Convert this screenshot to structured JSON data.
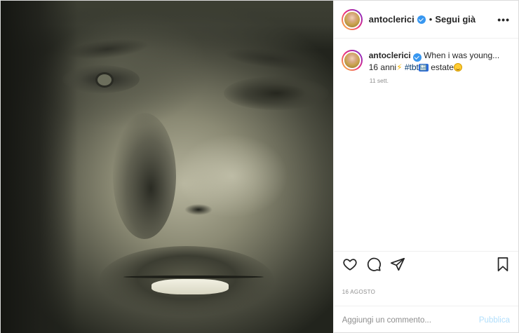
{
  "post": {
    "username": "antoclerici",
    "follow_label": "Segui già",
    "separator": "•",
    "more_label": "•••",
    "caption": {
      "username": "antoclerici",
      "text_part1": "When i was young... 16 anni",
      "bolt_emoji": "⚡",
      "hashtag": "#tbt",
      "box_emoji": "🔙",
      "text_part2": " estate",
      "smile_emoji": "😃"
    },
    "caption_time": "11 sett.",
    "date": "16 AGOSTO",
    "comment_placeholder": "Aggiungi un commento...",
    "publish_label": "Pubblica"
  },
  "icons": {
    "like": "heart-icon",
    "comment": "comment-icon",
    "share": "share-icon",
    "save": "bookmark-icon",
    "verified": "verified-badge-icon"
  },
  "colors": {
    "verified": "#3897f0",
    "publish": "#b2dffc",
    "muted": "#8e8e8e",
    "hashtag": "#00376b"
  }
}
